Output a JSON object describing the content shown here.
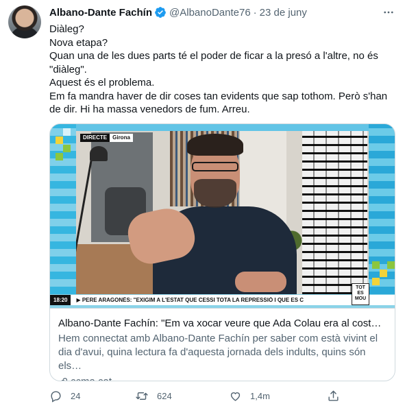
{
  "author": {
    "name": "Albano-Dante Fachín",
    "handle": "@AlbanoDante76",
    "separator": "·",
    "date": "23 de juny"
  },
  "tweet_lines": [
    "Diàleg?",
    "Nova etapa?",
    "Quan una de les dues parts té el poder de ficar a la presó a l'altre, no és \"diàleg\".",
    "Aquest és el problema.",
    "Em fa mandra haver de dir coses tan evidents que sap tothom. Però s'han de dir. Hi ha massa venedors de fum. Arreu."
  ],
  "card": {
    "title": "Albano-Dante Fachín: \"Em va xocar veure que Ada Colau era al costat …",
    "description": "Hem connectat amb Albano-Dante Fachín per saber com està vivint el dia d'avui, quina lectura fa d'aquesta jornada dels indults, quins són els…",
    "domain": "ccma.cat",
    "media": {
      "live_label": "DIRECTE",
      "place_label": "Girona",
      "time": "18:20",
      "ticker": "▶ PERE ARAGONÈS: \"EXIGIM A L'ESTAT QUE CESSI TOTA LA REPRESSIÓ I QUE ES C",
      "logo": "TOT ES MOU"
    }
  },
  "actions": {
    "replies": "24",
    "retweets": "624",
    "likes": "1,4m",
    "share": ""
  },
  "colors": {
    "text": "#0f1419",
    "secondary": "#536471",
    "border": "#cfd9de",
    "verified": "#1d9bf0"
  },
  "icons": [
    "verified-icon",
    "more-icon",
    "link-icon",
    "reply-icon",
    "retweet-icon",
    "like-icon",
    "share-icon"
  ]
}
